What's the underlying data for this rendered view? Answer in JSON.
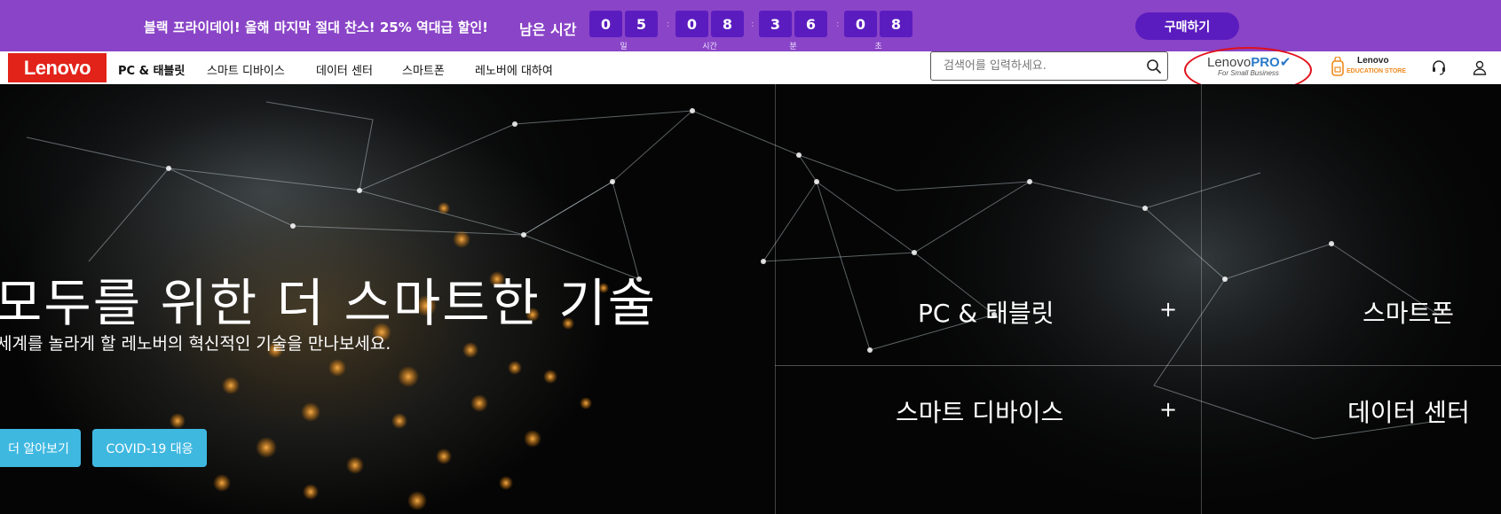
{
  "promo": {
    "text": "블랙 프라이데이! 올해 마지막 절대 찬스! 25% 역대급 할인!",
    "remaining_label": "남은 시간",
    "countdown": [
      {
        "digits": [
          "0",
          "5"
        ],
        "label": "일"
      },
      {
        "digits": [
          "0",
          "8"
        ],
        "label": "시간"
      },
      {
        "digits": [
          "3",
          "6"
        ],
        "label": "분"
      },
      {
        "digits": [
          "0",
          "8"
        ],
        "label": "초"
      }
    ],
    "separator": ":",
    "buy_label": "구매하기"
  },
  "nav": {
    "logo": "Lenovo",
    "items": [
      "PC & 태블릿",
      "스마트 디바이스",
      "데이터 센터",
      "스마트폰",
      "레노버에 대하여"
    ],
    "search_placeholder": "검색어를 입력하세요.",
    "pro_logo_main": "Lenovo",
    "pro_logo_pro": "PRO",
    "pro_logo_sub": "For Small Business",
    "edu_logo_top": "Lenovo",
    "edu_logo_bottom": "EDUCATION STORE"
  },
  "hero": {
    "title": "모두를 위한 더 스마트한 기술",
    "subtitle": "세계를 놀라게 할 레노버의 혁신적인 기술을 만나보세요.",
    "learn_more": "더 알아보기",
    "covid": "COVID-19 대응",
    "categories": [
      "PC & 태블릿",
      "스마트폰",
      "스마트 디바이스",
      "데이터 센터"
    ],
    "plus": "+"
  },
  "colors": {
    "promo_bg": "#8a44c7",
    "countdown_bg": "#5b1cbf",
    "lenovo_red": "#e2231a",
    "cta_cyan": "#3fb8e0"
  }
}
